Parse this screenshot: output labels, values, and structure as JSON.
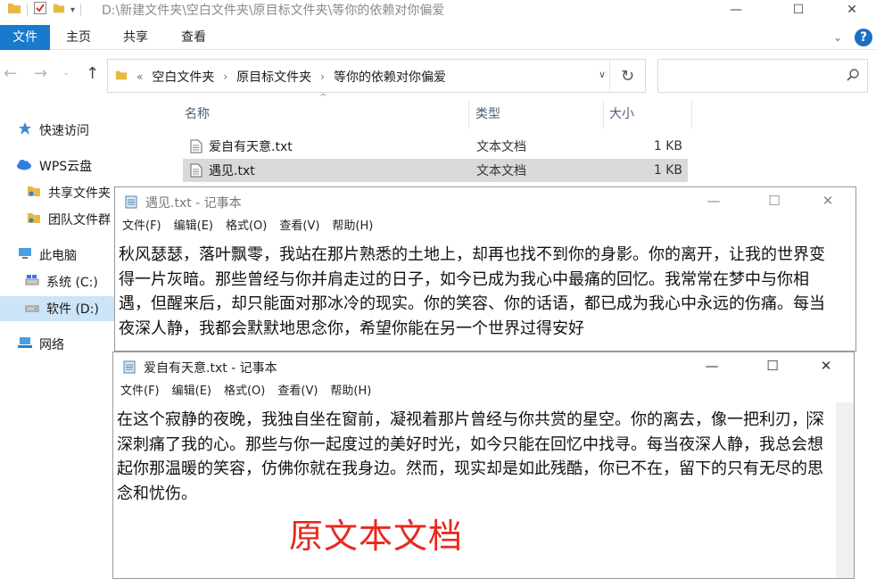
{
  "explorer": {
    "title_path": "D:\\新建文件夹\\空白文件夹\\原目标文件夹\\等你的依赖对你偏爱",
    "ribbon_tabs": [
      "文件",
      "主页",
      "共享",
      "查看"
    ],
    "address_segments": [
      "空白文件夹",
      "原目标文件夹",
      "等你的依赖对你偏爱"
    ],
    "address_chevron": "«",
    "nav_items": [
      {
        "label": "快速访问",
        "icon": "star-icon"
      },
      {
        "label": "WPS云盘",
        "icon": "cloud-icon"
      },
      {
        "label": "共享文件夹",
        "icon": "shared-folder-icon"
      },
      {
        "label": "团队文件群",
        "icon": "team-folder-icon"
      },
      {
        "label": "此电脑",
        "icon": "computer-icon"
      },
      {
        "label": "系统 (C:)",
        "icon": "drive-c-icon"
      },
      {
        "label": "软件 (D:)",
        "icon": "drive-d-icon"
      },
      {
        "label": "网络",
        "icon": "network-icon"
      }
    ],
    "columns": {
      "name": "名称",
      "type": "类型",
      "size": "大小"
    },
    "files": [
      {
        "name": "爱自有天意.txt",
        "type": "文本文档",
        "size": "1 KB",
        "selected": false
      },
      {
        "name": "遇见.txt",
        "type": "文本文档",
        "size": "1 KB",
        "selected": true
      }
    ]
  },
  "notepad_back": {
    "title": "遇见.txt - 记事本",
    "menu": [
      "文件(F)",
      "编辑(E)",
      "格式(O)",
      "查看(V)",
      "帮助(H)"
    ],
    "text": "秋风瑟瑟，落叶飘零，我站在那片熟悉的土地上，却再也找不到你的身影。你的离开，让我的世界变得一片灰暗。那些曾经与你并肩走过的日子，如今已成为我心中最痛的回忆。我常常在梦中与你相遇，但醒来后，却只能面对那冰冷的现实。你的笑容、你的话语，都已成为我心中永远的伤痛。每当夜深人静，我都会默默地思念你，希望你能在另一个世界过得安好"
  },
  "notepad_front": {
    "title": "爱自有天意.txt - 记事本",
    "menu": [
      "文件(F)",
      "编辑(E)",
      "格式(O)",
      "查看(V)",
      "帮助(H)"
    ],
    "text_before_caret": "在这个寂静的夜晚，我独自坐在窗前，凝视着那片曾经与你共赏的星空。你的离去，像一把利刃，",
    "text_after_caret": "深深刺痛了我的心。那些与你一起度过的美好时光，如今只能在回忆中找寻。每当夜深人静，我总会想起你那温暖的笑容，仿佛你就在我身边。然而，现实却是如此残酷，你已不在，留下的只有无尽的思念和忧伤。"
  },
  "overlay_label": "原文本文档",
  "colors": {
    "accent": "#1979ca",
    "label_red": "#e8281e",
    "selection": "#cce4f7"
  }
}
